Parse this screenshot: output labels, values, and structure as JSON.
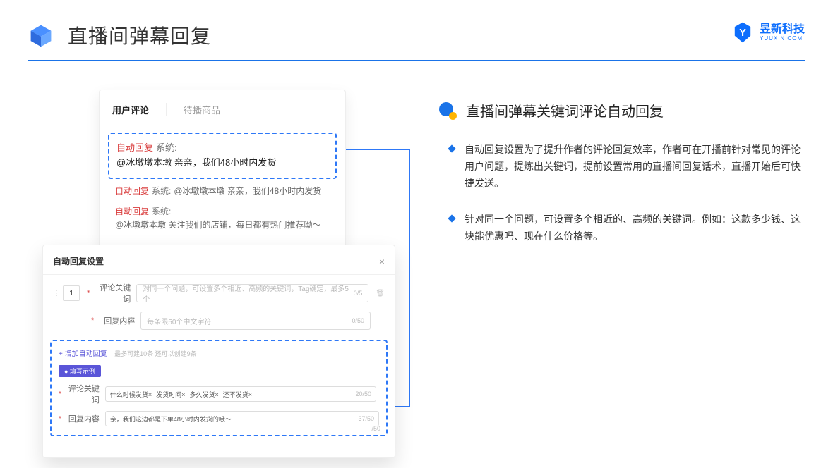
{
  "header": {
    "title": "直播间弹幕回复"
  },
  "brand": {
    "name": "昱新科技",
    "sub": "YUUXIN.COM"
  },
  "comments": {
    "tab_active": "用户评论",
    "tab_other": "待播商品",
    "hl_tag": "自动回复",
    "hl_sys": "系统:",
    "hl_text": "@冰墩墩本墩 亲亲，我们48小时内发货",
    "r2_tag": "自动回复",
    "r2_sys": "系统:",
    "r2_text": "@冰墩墩本墩 亲亲，我们48小时内发货",
    "r3_tag": "自动回复",
    "r3_sys": "系统:",
    "r3_text": "@冰墩墩本墩 关注我们的店铺，每日都有热门推荐呦～"
  },
  "settings": {
    "title": "自动回复设置",
    "num": "1",
    "kw_label": "评论关键词",
    "kw_ph": "对同一个问题，可设置多个相近、高频的关键词，Tag确定，最多5个",
    "kw_cnt": "0/5",
    "reply_label": "回复内容",
    "reply_ph": "每条限50个中文字符",
    "reply_cnt": "0/50",
    "add": "+ 增加自动回复",
    "add_hint": "最多可建10条 还可以创建9条",
    "ex_badge": "● 填写示例",
    "ex_kw_label": "评论关键词",
    "tag1": "什么时候发货×",
    "tag2": "发货时间×",
    "tag3": "多久发货×",
    "tag4": "还不发货×",
    "ex_kw_cnt": "20/50",
    "ex_reply_label": "回复内容",
    "ex_reply_text": "亲，我们这边都是下单48小时内发货的哦～",
    "ex_reply_cnt": "37/50",
    "tail": "/50"
  },
  "right": {
    "title": "直播间弹幕关键词评论自动回复",
    "b1": "自动回复设置为了提升作者的评论回复效率，作者可在开播前针对常见的评论用户问题，提炼出关键词，提前设置常用的直播间回复话术，直播开始后可快捷发送。",
    "b2": "针对同一个问题，可设置多个相近的、高频的关键词。例如：这款多少钱、这块能优惠吗、现在什么价格等。"
  }
}
